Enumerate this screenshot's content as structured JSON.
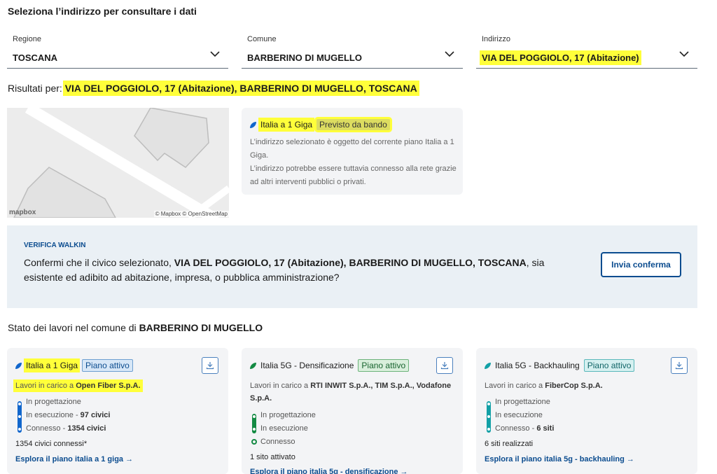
{
  "heading": "Seleziona l’indirizzo per consultare i dati",
  "selects": {
    "regione": {
      "label": "Regione",
      "value": "TOSCANA"
    },
    "comune": {
      "label": "Comune",
      "value": "BARBERINO DI MUGELLO"
    },
    "indirizzo": {
      "label": "Indirizzo",
      "value": "VIA DEL POGGIOLO, 17 (Abitazione)"
    }
  },
  "results": {
    "prefix": "Risultati per:",
    "value": "VIA DEL POGGIOLO, 17 (Abitazione), BARBERINO DI MUGELLO, TOSCANA"
  },
  "map": {
    "logo": "mapbox",
    "attribution": "© Mapbox © OpenStreetMap"
  },
  "info_card": {
    "title": "Italia a 1 Giga",
    "badge": "Previsto da bando",
    "line1": "L’indirizzo selezionato è oggetto del corrente piano Italia a 1 Giga.",
    "line2": "L’indirizzo potrebbe essere tuttavia connesso alla rete grazie ad altri interventi pubblici o privati."
  },
  "walkin": {
    "title": "VERIFICA WALKIN",
    "text_before": "Confermi che il civico selezionato,",
    "text_address": "VIA DEL POGGIOLO, 17 (Abitazione), BARBERINO DI MUGELLO, TOSCANA",
    "text_after": ", sia esistente ed adibito ad abitazione, impresa, o pubblica amministrazione?",
    "button": "Invia conferma"
  },
  "stato": {
    "prefix": "Stato dei lavori nel comune di",
    "comune": "BARBERINO DI MUGELLO"
  },
  "cards": [
    {
      "title": "Italia a 1 Giga",
      "badge": "Piano attivo",
      "lavori_prefix": "Lavori in carico a",
      "lavori_company": "Open Fiber S.p.A.",
      "steps": [
        {
          "label": "In progettazione",
          "detail": ""
        },
        {
          "label": "In esecuzione",
          "detail": "97 civici"
        },
        {
          "label": "Connesso",
          "detail": "1354 civici"
        }
      ],
      "summary": "1354 civici connessi*",
      "link": "Esplora il piano italia a 1 giga →",
      "color": "#1166cc"
    },
    {
      "title": "Italia 5G - Densificazione",
      "badge": "Piano attivo",
      "lavori_prefix": "Lavori in carico a",
      "lavori_company": "RTI INWIT S.p.A., TIM S.p.A., Vodafone S.p.A.",
      "steps": [
        {
          "label": "In progettazione",
          "detail": ""
        },
        {
          "label": "In esecuzione",
          "detail": ""
        },
        {
          "label": "Connesso",
          "detail": ""
        }
      ],
      "summary": "1 sito attivato",
      "link": "Esplora il piano italia 5g - densificazione →",
      "color": "#138a43"
    },
    {
      "title": "Italia 5G - Backhauling",
      "badge": "Piano attivo",
      "lavori_prefix": "Lavori in carico a",
      "lavori_company": "FiberCop S.p.A.",
      "steps": [
        {
          "label": "In progettazione",
          "detail": ""
        },
        {
          "label": "In esecuzione",
          "detail": ""
        },
        {
          "label": "Connesso",
          "detail": "6 siti"
        }
      ],
      "summary": "6 siti realizzati",
      "link": "Esplora il piano italia 5g - backhauling →",
      "color": "#12a0a6"
    }
  ]
}
